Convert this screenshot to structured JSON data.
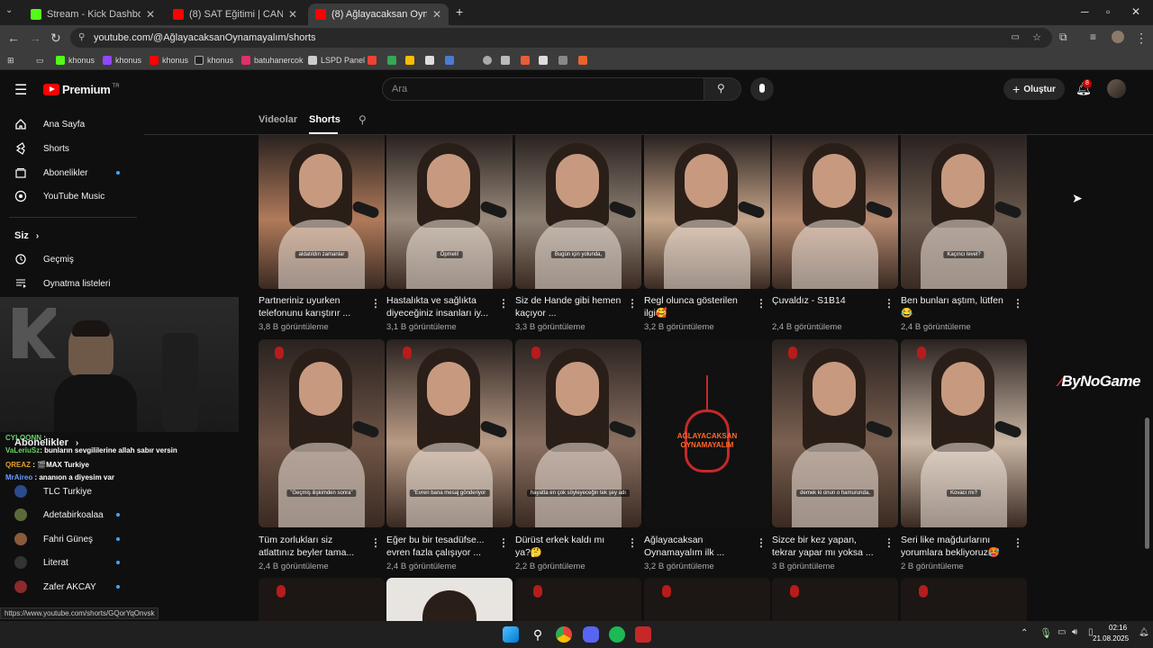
{
  "browser": {
    "tabs": [
      {
        "title": "Stream - Kick Dashboard",
        "icon": "kick-icon",
        "color": "#53fc18"
      },
      {
        "title": "(8) SAT Eğitimi | CANİK ACADEM",
        "icon": "youtube-icon",
        "color": "#ff0000"
      },
      {
        "title": "(8) Ağlayacaksan Oynamayalım",
        "icon": "youtube-icon",
        "color": "#ff0000"
      }
    ],
    "url": "youtube.com/@AğlayacaksanOynamayalım/shorts",
    "bookmarks": [
      "khonus",
      "khonus",
      "khonus",
      "khonus",
      "batuhanercok",
      "LSPD Panel"
    ],
    "status_url": "https://www.youtube.com/shorts/GQorYqOnvsk"
  },
  "youtube": {
    "logo": "Premium",
    "logo_region": "TR",
    "search_placeholder": "Ara",
    "create_label": "Oluştur",
    "notif_count": "8",
    "sidebar": {
      "main": [
        {
          "label": "Ana Sayfa",
          "icon": "home-icon"
        },
        {
          "label": "Shorts",
          "icon": "shorts-icon"
        },
        {
          "label": "Abonelikler",
          "icon": "subscriptions-icon"
        },
        {
          "label": "YouTube Music",
          "icon": "music-icon"
        }
      ],
      "you_header": "Siz",
      "you": [
        {
          "label": "Geçmiş",
          "icon": "history-icon"
        },
        {
          "label": "Oynatma listeleri",
          "icon": "playlists-icon"
        }
      ],
      "subs_header": "Abonelikler",
      "subs": [
        {
          "label": "TLC Turkiye"
        },
        {
          "label": "Adetabirkoalaa"
        },
        {
          "label": "Fahri Güneş"
        },
        {
          "label": "Literat"
        },
        {
          "label": "Zafer AKCAY"
        }
      ]
    },
    "channel_tabs": [
      "Videolar",
      "Shorts"
    ],
    "row1": [
      {
        "title": "Partneriniz uyurken telefonunu karıştırır ...",
        "views": "3,8 B görüntüleme",
        "caption": "aldatıldın zamanlar",
        "bg": "#b07a5a"
      },
      {
        "title": "Hastalıkta ve sağlıkta diyeceğiniz insanları iy...",
        "views": "3,1 B görüntüleme",
        "caption": "Öpmeli!",
        "bg": "#9a8a7c"
      },
      {
        "title": "Siz de Hande gibi hemen kaçıyor ...",
        "views": "3,3 B görüntüleme",
        "caption": "Bugün için yolunda,",
        "bg": "#8c7f72"
      },
      {
        "title": "Regl olunca gösterilen ilgi🥰",
        "views": "3,2 B görüntüleme",
        "caption": "",
        "bg": "#c4a58a"
      },
      {
        "title": "Çuvaldız - S1B14",
        "views": "2,4 B görüntüleme",
        "caption": "",
        "bg": "#b58a70"
      },
      {
        "title": "Ben bunları aştım, lütfen 😂",
        "views": "2,4 B görüntüleme",
        "caption": "Kaçıncı level?",
        "bg": "#6b5a4e"
      }
    ],
    "row2": [
      {
        "title": "Tüm zorlukları siz atlattınız beyler tama...",
        "views": "2,4 B görüntüleme",
        "caption": "\"Geçmiş ilişkimden sonra\"",
        "bg": "#6e5446"
      },
      {
        "title": "Eğer bu bir tesadüfse... evren fazla çalışıyor ...",
        "views": "2,4 B görüntüleme",
        "caption": "\"Evren bana mesaj gönderiyor",
        "bg": "#b89a84"
      },
      {
        "title": "Dürüst erkek kaldı mı ya?🤔",
        "views": "2,2 B görüntüleme",
        "caption": "hayatta en çok söyleyeceğin tek şey adı",
        "bg": "#8a7062"
      },
      {
        "title": "Ağlayacaksan Oynamayalım ilk ...",
        "views": "3,2 B görüntüleme",
        "caption": "",
        "bg": "#141414"
      },
      {
        "title": "Sizce bir kez yapan, tekrar yapar mı yoksa ...",
        "views": "3 B görüntüleme",
        "caption": "demek ki onun o hamurunda,",
        "bg": "#7a6050"
      },
      {
        "title": "Seri like mağdurlarını yorumlara bekliyoruz🥵",
        "views": "2 B görüntüleme",
        "caption": "Kovacı mı?",
        "bg": "#c9b6a4"
      }
    ],
    "logo_card_text": "AĞLAYACAKSAN OYNAMAYALIM"
  },
  "overlay": {
    "brand": "ByNoGame",
    "chat": [
      {
        "user": "CYLOONN",
        "msg": ":",
        "color": "#6bd36b"
      },
      {
        "user": "VaLeriuSz",
        "msg": ": bunların sevgililerine allah sabır versin",
        "color": "#6bd36b"
      },
      {
        "user": "QREAZ",
        "msg": ": 🎬MAX Turkiye",
        "color": "#e0a030"
      },
      {
        "user": "MrAireo",
        "msg": ": ananıon a diyesim var",
        "color": "#6a9bff"
      }
    ]
  },
  "taskbar": {
    "time": "02:16",
    "date": "21.08.2025"
  }
}
